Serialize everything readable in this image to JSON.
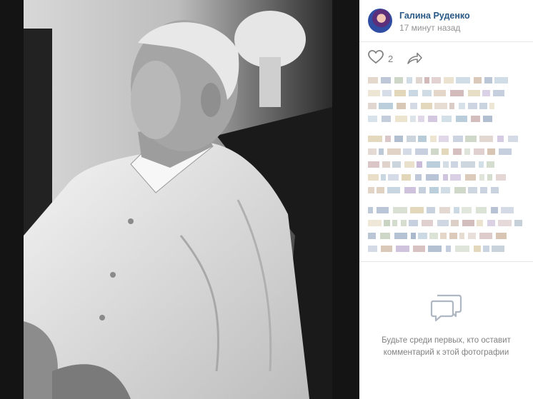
{
  "post": {
    "author": "Галина Руденко",
    "time": "17 минут назад",
    "likes": "2"
  },
  "comments": {
    "empty_line1": "Будьте среди первых, кто оставит",
    "empty_line2": "комментарий к этой фотографии"
  },
  "icons": {
    "like": "heart-icon",
    "share": "share-arrow-icon",
    "comments": "speech-bubbles-icon"
  },
  "colors": {
    "accent": "#2a5885",
    "muted": "#828282",
    "background": "#1f1f1f"
  }
}
